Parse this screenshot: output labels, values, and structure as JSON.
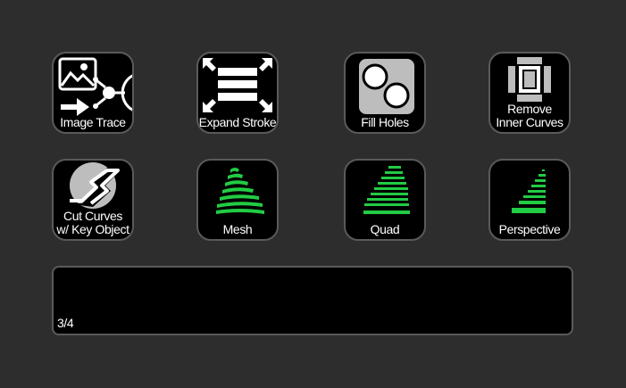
{
  "keys": {
    "image_trace": {
      "label": "Image Trace",
      "icon": "image-trace-icon"
    },
    "expand_stroke": {
      "label": "Expand Stroke",
      "icon": "expand-stroke-icon"
    },
    "fill_holes": {
      "label": "Fill Holes",
      "icon": "fill-holes-icon"
    },
    "remove_inner_curves": {
      "label": "Remove\nInner Curves",
      "icon": "remove-inner-curves-icon"
    },
    "cut_curves": {
      "label": "Cut Curves\nw/ Key Object",
      "icon": "cut-curves-icon"
    },
    "mesh": {
      "label": "Mesh",
      "icon": "mesh-icon"
    },
    "quad": {
      "label": "Quad",
      "icon": "quad-icon"
    },
    "perspective": {
      "label": "Perspective",
      "icon": "perspective-icon"
    }
  },
  "status_bar": {
    "page": "3/4"
  },
  "colors": {
    "background": "#2d2d2d",
    "key_fill": "#000000",
    "key_border": "#5a5a5a",
    "accent_green": "#22cc44",
    "icon_gray": "#bdbdbd"
  }
}
